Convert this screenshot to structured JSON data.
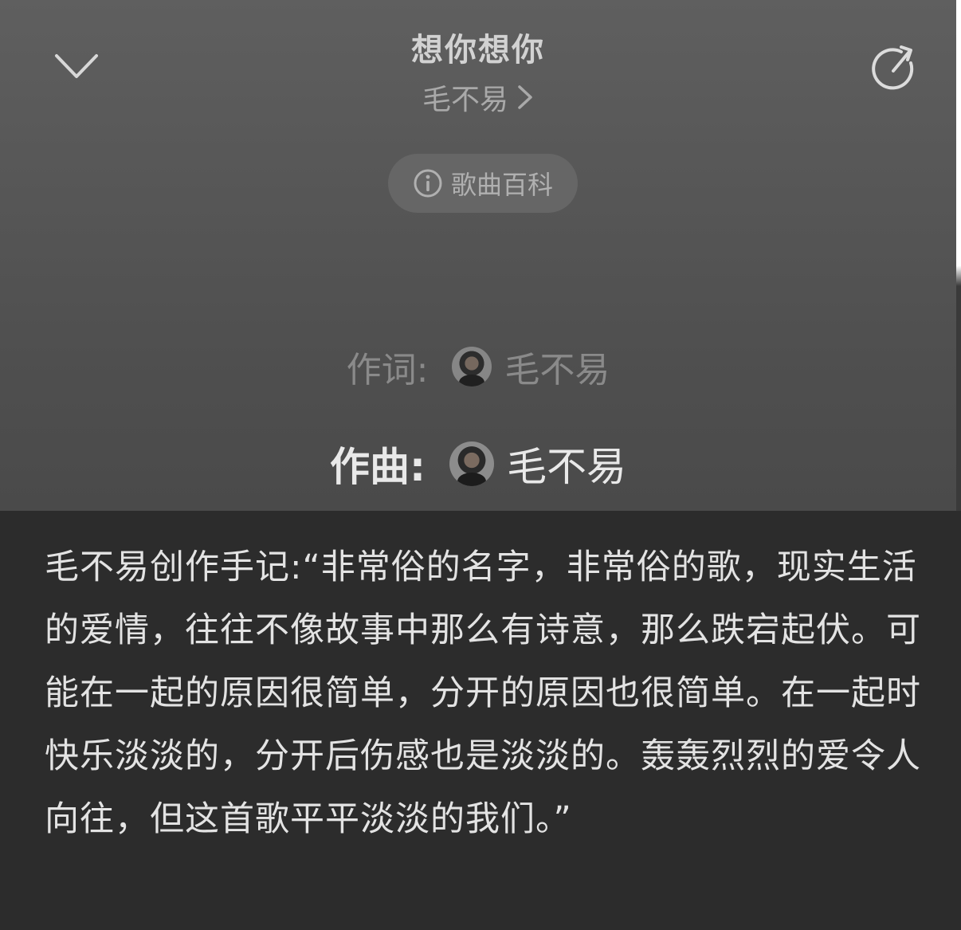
{
  "header": {
    "collapse_icon": "chevron-down-icon",
    "song_title": "想你想你",
    "artist": "毛不易",
    "artist_chevron_icon": "chevron-right-icon",
    "share_icon": "share-rotate-icon"
  },
  "wiki": {
    "icon": "info-icon",
    "label": "歌曲百科"
  },
  "credits": {
    "lyricist_label": "作词:",
    "lyricist_name": "毛不易",
    "composer_label": "作曲:",
    "composer_name": "毛不易"
  },
  "notes": {
    "text": "毛不易创作手记:“非常俗的名字，非常俗的歌，现实生活的爱情，往往不像故事中那么有诗意，那么跌宕起伏。可能在一起的原因很简单，分开的原因也很简单。在一起时快乐淡淡的，分开后伤感也是淡淡的。轰轰烈烈的爱令人向往，但这首歌平平淡淡的我们。”"
  },
  "colors": {
    "player_bg": "#575757",
    "notes_bg": "#2c2c2c",
    "accent_text": "#e9e9e9"
  }
}
